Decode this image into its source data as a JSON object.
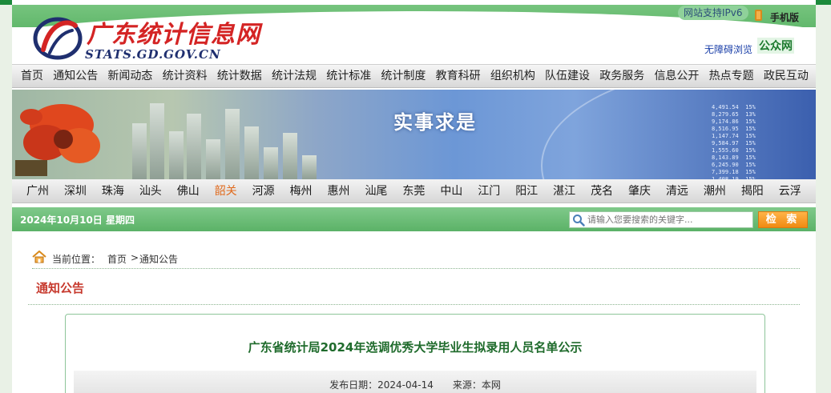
{
  "header": {
    "logo_cn": "广东统计信息网",
    "logo_en": "STATS.GD.GOV.CN",
    "ipv6_badge": "网站支持IPv6",
    "mobile_label": "手机版",
    "accessibility_link": "无障碍浏览",
    "public_account": "公众网"
  },
  "nav": {
    "items": [
      "首页",
      "通知公告",
      "新闻动态",
      "统计资料",
      "统计数据",
      "统计法规",
      "统计标准",
      "统计制度",
      "教育科研",
      "组织机构",
      "队伍建设",
      "政务服务",
      "信息公开",
      "热点专题",
      "政民互动"
    ]
  },
  "banner": {
    "slogan": "实事求是"
  },
  "cities": {
    "items": [
      "广州",
      "深圳",
      "珠海",
      "汕头",
      "佛山",
      "韶关",
      "河源",
      "梅州",
      "惠州",
      "汕尾",
      "东莞",
      "中山",
      "江门",
      "阳江",
      "湛江",
      "茂名",
      "肇庆",
      "清远",
      "潮州",
      "揭阳",
      "云浮"
    ],
    "active_index": 5,
    "active_color": "#e06a1d"
  },
  "toolbar": {
    "date": "2024年10月10日 星期四",
    "search_placeholder": "请输入您要搜索的关键字...",
    "search_button": "检 索"
  },
  "breadcrumb": {
    "label": "当前位置：",
    "home": "首页",
    "separator": ">",
    "current": "通知公告"
  },
  "section": {
    "title": "通知公告"
  },
  "article": {
    "title": "广东省统计局2024年选调优秀大学毕业生拟录用人员名单公示",
    "meta": "发布日期：2024-04-14　　来源：本网"
  },
  "colors": {
    "brand_green": "#1c8a3b",
    "logo_red": "#d42424",
    "section_red": "#c73a2e",
    "search_orange": "#f08a12"
  }
}
